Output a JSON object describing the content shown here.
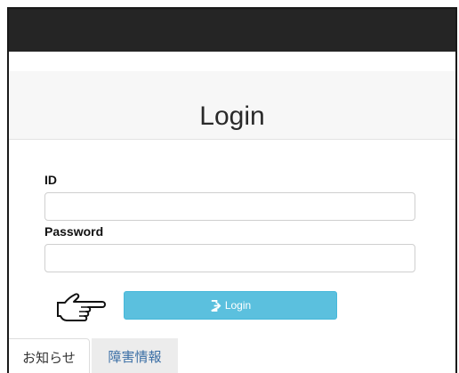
{
  "header": {
    "title": "Login"
  },
  "form": {
    "id_label": "ID",
    "id_value": "",
    "password_label": "Password",
    "password_value": ""
  },
  "login_button": {
    "label": "Login",
    "icon": "sign-in-icon",
    "color": "#5bc0de"
  },
  "pointer": {
    "icon": "pointing-hand-icon"
  },
  "tabs": [
    {
      "label": "お知らせ",
      "active": true
    },
    {
      "label": "障害情報",
      "active": false
    }
  ]
}
